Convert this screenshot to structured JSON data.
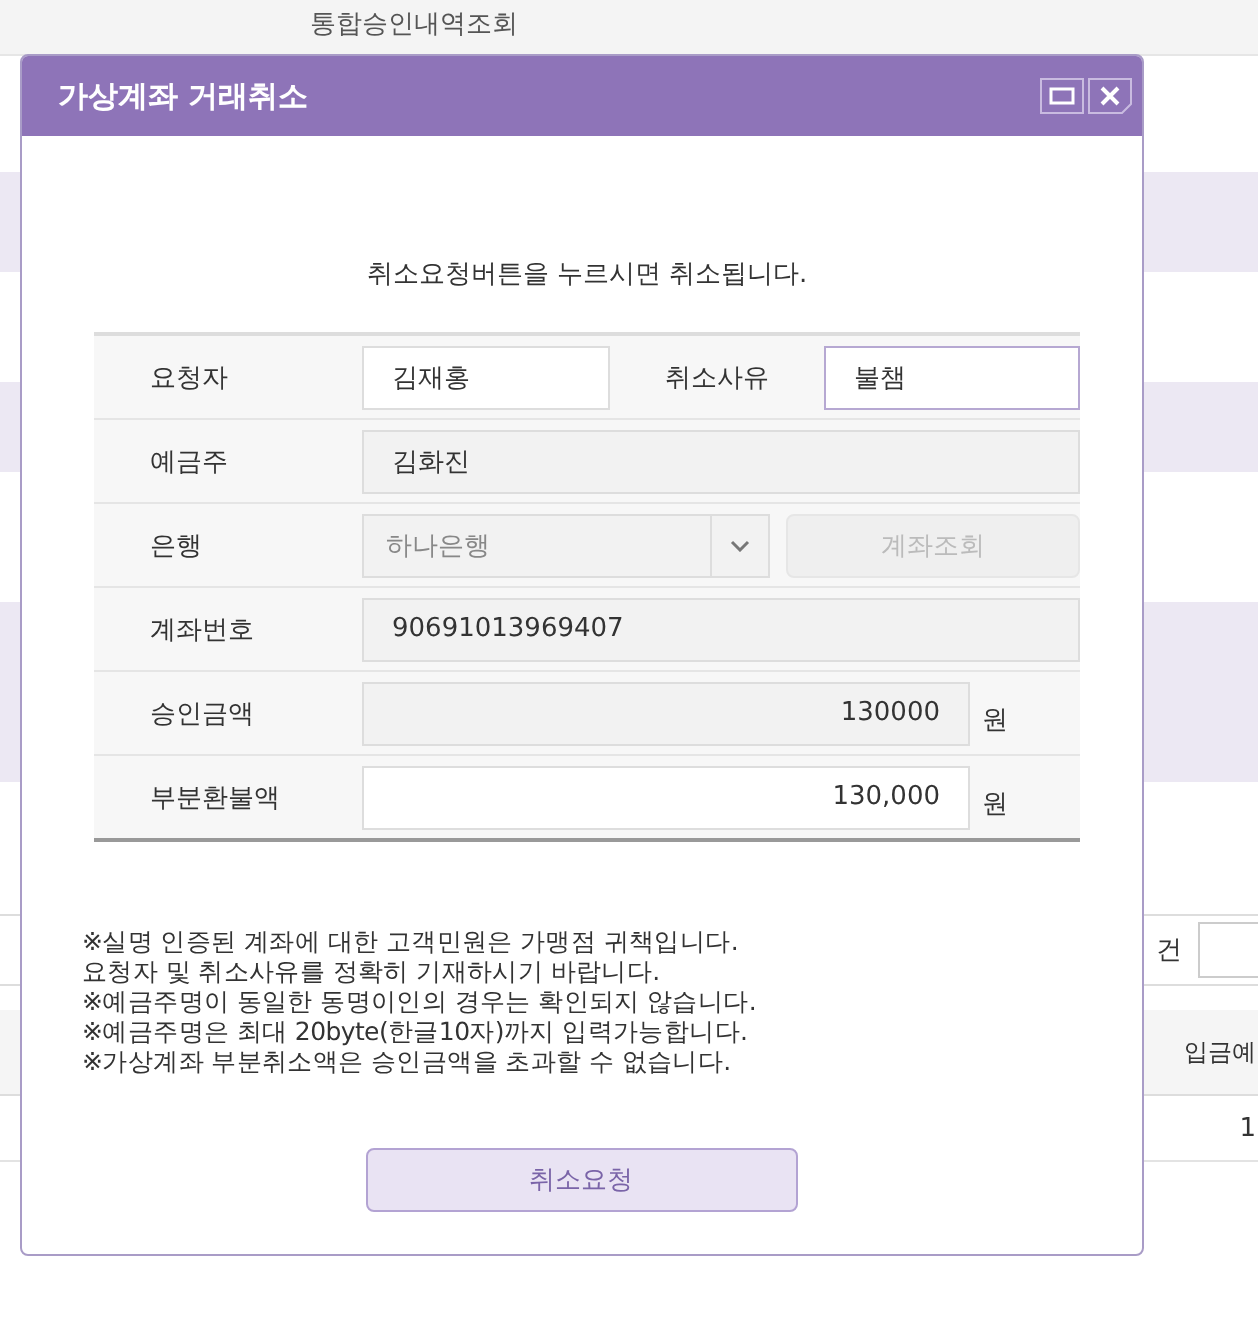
{
  "background": {
    "tab_label": "통합승인내역조회",
    "count_unit": "건",
    "column_header": "입금예",
    "cell": "1"
  },
  "dialog": {
    "title": "가상계좌 거래취소",
    "message": "취소요청버튼을 누르시면 취소됩니다.",
    "fields": [
      {
        "kind": "pair",
        "label": "요청자",
        "value": "김재홍",
        "disabled": false,
        "label2": "취소사유",
        "value2": "불챔",
        "focused2": true
      },
      {
        "kind": "text",
        "label": "예금주",
        "value": "김화진",
        "disabled": true
      },
      {
        "kind": "select",
        "label": "은행",
        "value": "하나은행",
        "button": "계좌조회",
        "disabled": true
      },
      {
        "kind": "text",
        "label": "계좌번호",
        "value": "90691013969407",
        "disabled": true
      },
      {
        "kind": "amount",
        "label": "승인금액",
        "value": "130000",
        "unit": "원",
        "disabled": true
      },
      {
        "kind": "amount",
        "label": "부분환불액",
        "value": "130,000",
        "unit": "원",
        "disabled": false
      }
    ],
    "notes": [
      "※실명 인증된 계좌에 대한 고객민원은 가맹점 귀책입니다.",
      "요청자 및 취소사유를 정확히 기재하시기 바랍니다.",
      "※예금주명이 동일한 동명이인의 경우는 확인되지 않습니다.",
      "※예금주명은 최대 20byte(한글10자)까지 입력가능합니다.",
      "※가상계좌 부분취소액은 승인금액을 초과할 수 없습니다."
    ],
    "submit": "취소요청"
  }
}
